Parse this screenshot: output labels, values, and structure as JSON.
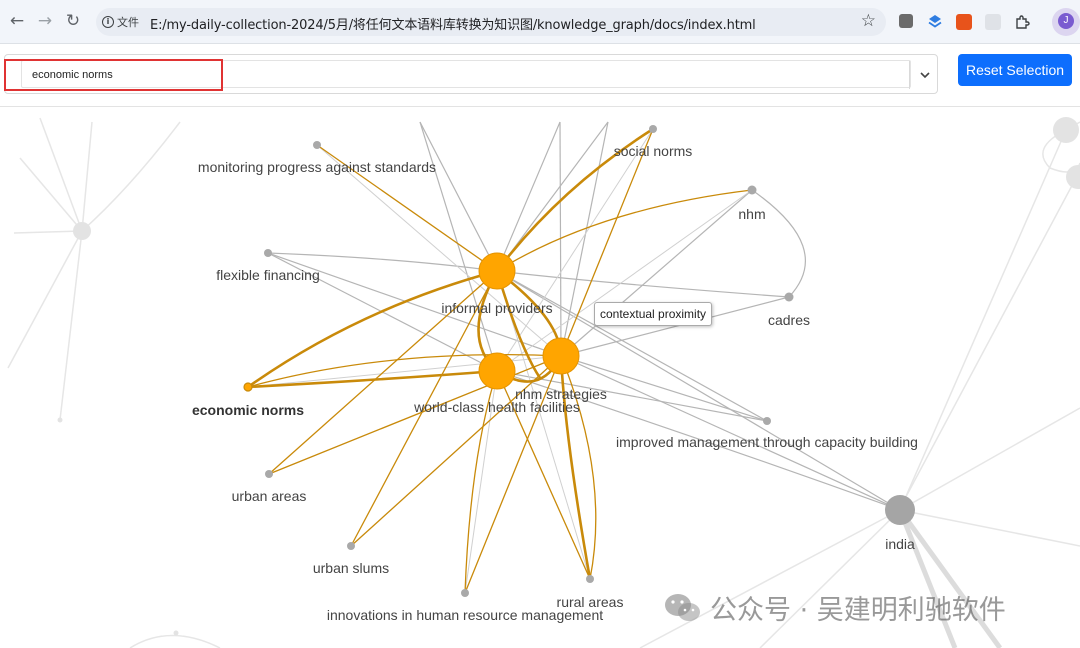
{
  "browser": {
    "url_chip": "文件",
    "url": "E:/my-daily-collection-2024/5月/将任何文本语料库转换为知识图/knowledge_graph/docs/index.html",
    "profile_initial": "J"
  },
  "toolbar": {
    "selected_value": "economic norms",
    "reset_label": "Reset Selection"
  },
  "graph": {
    "tooltip": "contextual proximity",
    "node_labels": {
      "informal_providers": "informal providers",
      "world_class": "world-class health facilities",
      "nhm_strategies": "nhm strategies",
      "economic_norms": "economic norms",
      "monitoring": "monitoring progress against standards",
      "social_norms": "social norms",
      "nhm": "nhm",
      "flexible_financing": "flexible financing",
      "cadres": "cadres",
      "improved_management": "improved management through capacity building",
      "urban_areas": "urban areas",
      "urban_slums": "urban slums",
      "innovations": "innovations in human resource management",
      "rural_areas": "rural areas",
      "india": "india"
    },
    "colors": {
      "highlight_node": "#ffa500",
      "highlight_edge": "#c98a0a",
      "dim_edge": "#b3b3b3",
      "faded": "#e5e5e5"
    }
  },
  "watermark": {
    "text": "公众号 · 吴建明利驰软件"
  }
}
